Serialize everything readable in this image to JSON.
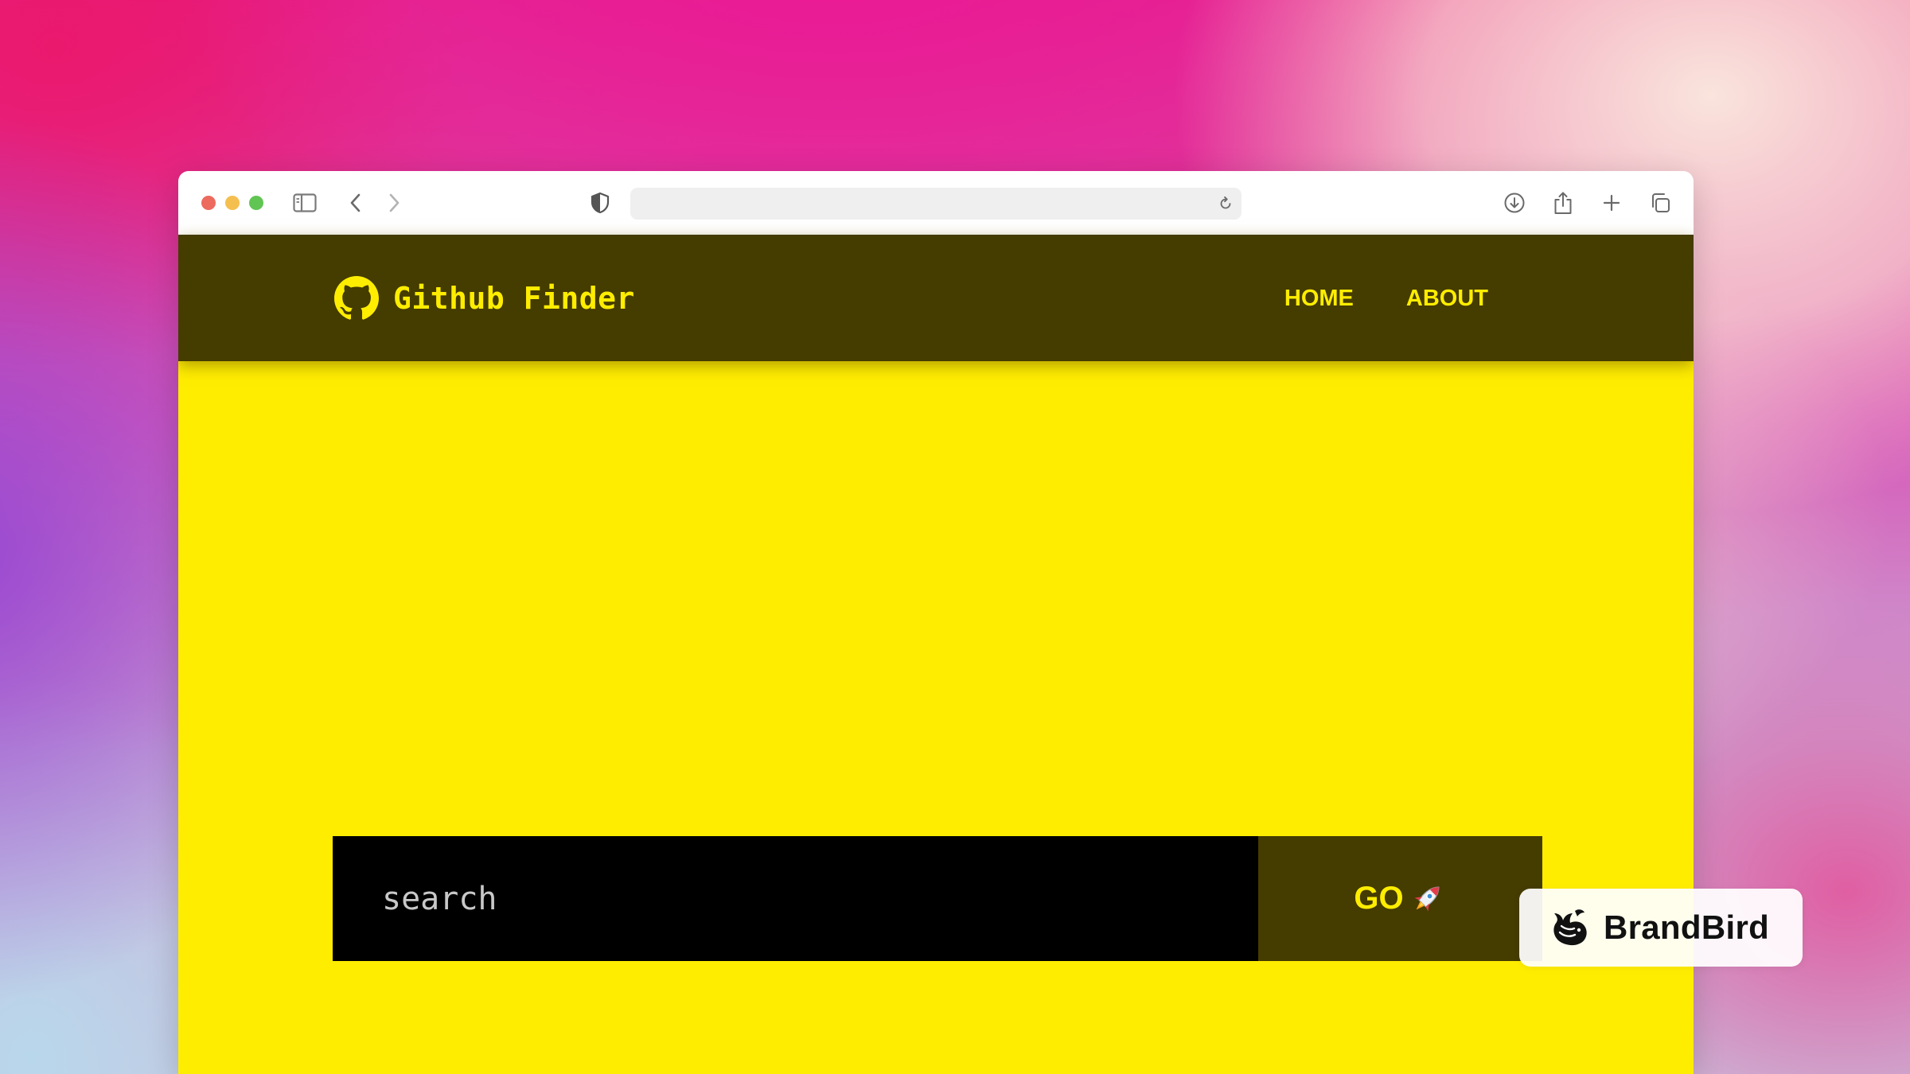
{
  "browser": {
    "address_value": "",
    "icons": {
      "sidebar": "sidebar-icon",
      "back": "chevron-left-icon",
      "forward": "chevron-right-icon",
      "privacy": "shield-icon",
      "reload": "reload-icon",
      "download": "download-icon",
      "share": "share-icon",
      "new_tab": "plus-icon",
      "tabs": "tabs-overview-icon"
    },
    "traffic_colors": [
      "#ed6a5e",
      "#f5bf4f",
      "#61c554"
    ]
  },
  "navbar": {
    "logo_icon": "github-icon",
    "title": "Github Finder",
    "links": [
      "HOME",
      "ABOUT"
    ]
  },
  "search": {
    "placeholder": "search",
    "button_label": "GO",
    "button_icon": "rocket-icon"
  },
  "watermark": {
    "text": "BrandBird",
    "logo_icon": "brandbird-logo-icon"
  },
  "colors": {
    "page_background": "#ffed00",
    "navbar_background": "#453c00",
    "accent_text": "#ffed00",
    "search_input_background": "#000000"
  }
}
